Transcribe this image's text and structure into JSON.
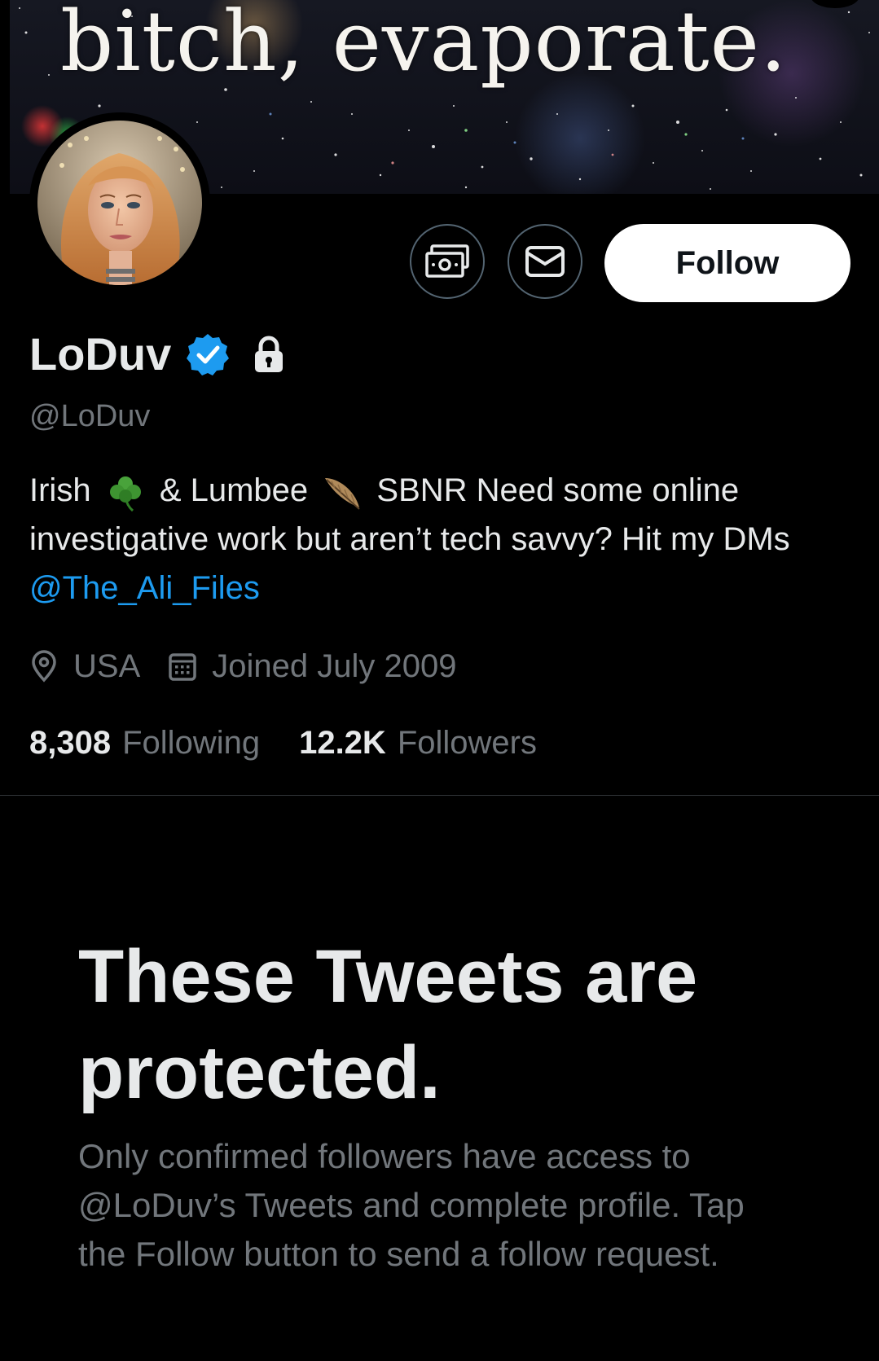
{
  "banner": {
    "text": "bitch, evaporate."
  },
  "profile": {
    "display_name": "LoDuv",
    "handle": "@LoDuv",
    "verified": true,
    "protected": true
  },
  "actions": {
    "tip_icon": "money-icon",
    "message_icon": "envelope-icon",
    "follow_label": "Follow"
  },
  "bio": {
    "part1": "Irish",
    "emoji1": "shamrock",
    "part2": "& Lumbee",
    "emoji2": "feather",
    "part3": "SBNR Need some online investigative work but aren’t tech savvy? Hit my DMs",
    "mention": "@The_Ali_Files"
  },
  "meta": {
    "location": "USA",
    "joined": "Joined July 2009"
  },
  "stats": {
    "following_count": "8,308",
    "following_label": "Following",
    "followers_count": "12.2K",
    "followers_label": "Followers"
  },
  "protected_notice": {
    "title": "These Tweets are protected.",
    "body": "Only confirmed followers have access to @LoDuv’s Tweets and complete profile. Tap the Follow button to send a follow request."
  },
  "colors": {
    "background": "#000000",
    "text_primary": "#e7e9ea",
    "text_secondary": "#71767b",
    "accent_blue": "#1d9bf0",
    "follow_button_bg": "#ffffff"
  }
}
